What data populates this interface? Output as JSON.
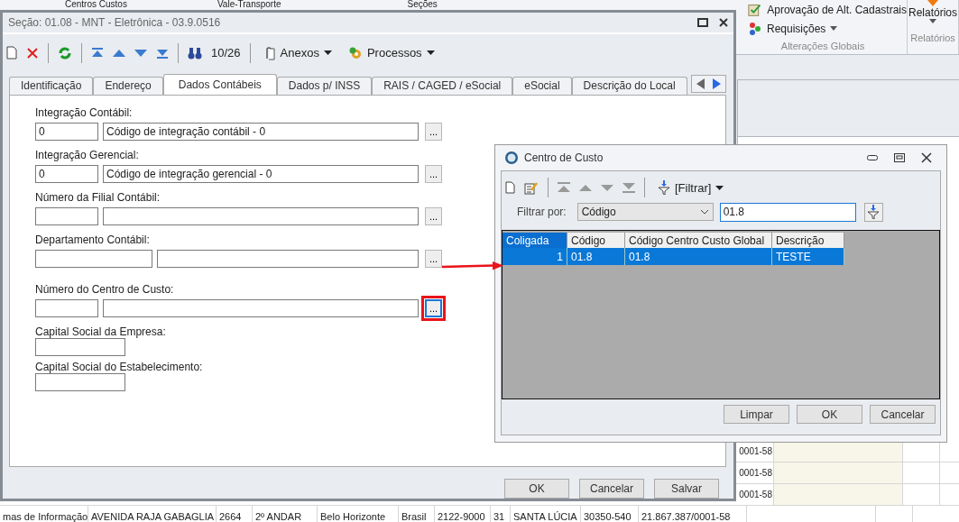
{
  "ribbon": {
    "top_items": [
      {
        "label": "Centros Custos"
      },
      {
        "label": "Vale-Transporte"
      },
      {
        "label": "Seções"
      }
    ],
    "approval": "Aprovação de Alt. Cadastrais",
    "requests": "Requisições",
    "group_label": "Alterações Globais",
    "reports_button": "Relatórios",
    "reports_group": "Relatórios"
  },
  "background_grid": {
    "partial_cells": [
      "0001-58",
      "0001-58",
      "0001-58"
    ],
    "last_row": [
      "mas de Informação",
      "AVENIDA RAJA GABAGLIA",
      "2664",
      "2º ANDAR",
      "Belo Horizonte",
      "Brasil",
      "2122-9000",
      "31",
      "SANTA LÚCIA",
      "30350-540",
      "21.867.387/0001-58"
    ]
  },
  "main_window": {
    "title": "Seção: 01.08 - MNT - Eletrônica - 03.9.0516",
    "toolbar": {
      "counter": "10/26",
      "menus": [
        "Anexos",
        "Processos"
      ]
    },
    "tabs": [
      {
        "label": "Identificação",
        "selected": false
      },
      {
        "label": "Endereço",
        "selected": false
      },
      {
        "label": "Dados Contábeis",
        "selected": true
      },
      {
        "label": "Dados p/ INSS",
        "selected": false
      },
      {
        "label": "RAIS / CAGED / eSocial",
        "selected": false
      },
      {
        "label": "eSocial",
        "selected": false
      },
      {
        "label": "Descrição do Local",
        "selected": false
      }
    ],
    "fields": [
      {
        "kind": "lookup",
        "label": "Integração Contábil:",
        "code": "0",
        "description": "Código de integração contábil - 0",
        "button": "...",
        "highlighted": false
      },
      {
        "kind": "lookup",
        "label": "Integração Gerencial:",
        "code": "0",
        "description": "Código de integração gerencial - 0",
        "button": "...",
        "highlighted": false
      },
      {
        "kind": "lookup",
        "label": "Número da Filial Contábil:",
        "button": "...",
        "highlighted": false
      },
      {
        "kind": "lookup-wide",
        "label": "Departamento Contábil:",
        "button": "...",
        "highlighted": false
      },
      {
        "kind": "lookup",
        "label": "Número do Centro de Custo:",
        "button": "...",
        "highlighted": true
      },
      {
        "kind": "value",
        "label": "Capital Social da Empresa:"
      },
      {
        "kind": "value",
        "label": "Capital Social do Estabelecimento:"
      }
    ],
    "buttons": [
      "OK",
      "Cancelar",
      "Salvar"
    ]
  },
  "lookup_dialog": {
    "title": "Centro de Custo",
    "filter_menu": "[Filtrar]",
    "filter_label": "Filtrar por:",
    "filter_field": "Código",
    "filter_value": "01.8",
    "columns": [
      {
        "label": "Coligada",
        "selected": true
      },
      {
        "label": "Código",
        "selected": false
      },
      {
        "label": "Código Centro Custo Global",
        "selected": false
      },
      {
        "label": "Descrição",
        "selected": false
      }
    ],
    "rows": [
      {
        "cells": [
          "1",
          "01.8",
          "01.8",
          "TESTE"
        ],
        "selected": true
      }
    ],
    "buttons": [
      "Limpar",
      "OK",
      "Cancelar"
    ]
  }
}
